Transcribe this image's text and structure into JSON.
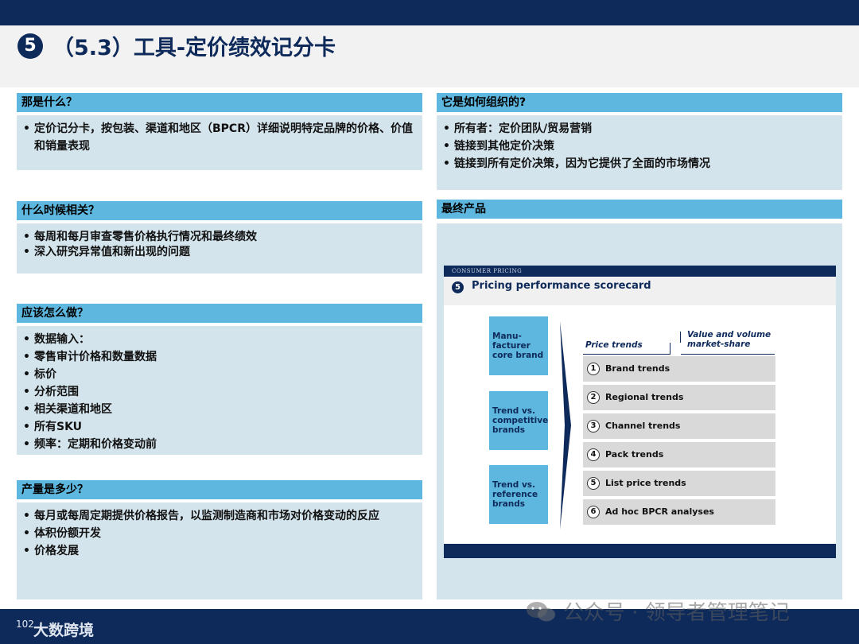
{
  "title": {
    "number": "5",
    "text": "（5.3）工具-定价绩效记分卡"
  },
  "left_sections": [
    {
      "heading": "那是什么？",
      "items": [
        "定价记分卡，按包装、渠道和地区（BPCR）详细说明特定品牌的价格、价值和销量表现"
      ]
    },
    {
      "heading": "什么时候相关？",
      "items": [
        "每周和每月审查零售价格执行情况和最终绩效",
        "深入研究异常值和新出现的问题"
      ]
    },
    {
      "heading": "应该怎么做？",
      "items": [
        "数据输入：",
        "零售审计价格和数量数据",
        "标价",
        "分析范围",
        "相关渠道和地区",
        "所有SKU",
        "频率：定期和价格变动前"
      ]
    },
    {
      "heading": "产量是多少？",
      "items": [
        "每月或每周定期提供价格报告，以监测制造商和市场对价格变动的反应",
        "体积份额开发",
        "价格发展"
      ]
    }
  ],
  "right_sections": [
    {
      "heading": "它是如何组织的?",
      "items": [
        "所有者：定价团队/贸易营销",
        "链接到其他定价决策",
        "链接到所有定价决策，因为它提供了全面的市场情况"
      ]
    },
    {
      "heading": "最终产品"
    }
  ],
  "scorecard": {
    "band_text": "CONSUMER PRICING",
    "number": "5",
    "title": "Pricing performance scorecard",
    "left_boxes": [
      "Manu-\nfacturer\ncore brand",
      "Trend vs.\ncompetitive\nbrands",
      "Trend vs.\nreference\nbrands"
    ],
    "col_price": "Price trends",
    "col_value": "Value and volume\nmarket-share",
    "rows": [
      {
        "num": "1",
        "label": "Brand trends"
      },
      {
        "num": "2",
        "label": "Regional trends"
      },
      {
        "num": "3",
        "label": "Channel trends"
      },
      {
        "num": "4",
        "label": "Pack trends"
      },
      {
        "num": "5",
        "label": "List price trends"
      },
      {
        "num": "6",
        "label": "Ad hoc BPCR analyses"
      }
    ]
  },
  "footer": {
    "page": "102",
    "brand": "大数跨境",
    "watermark": "公众号 · 领导者管理笔记",
    "wechat_icon": "wechat-icon"
  },
  "colors": {
    "navy": "#0e2a5a",
    "section_head": "#5db7de",
    "section_body": "#d4e4ec"
  }
}
